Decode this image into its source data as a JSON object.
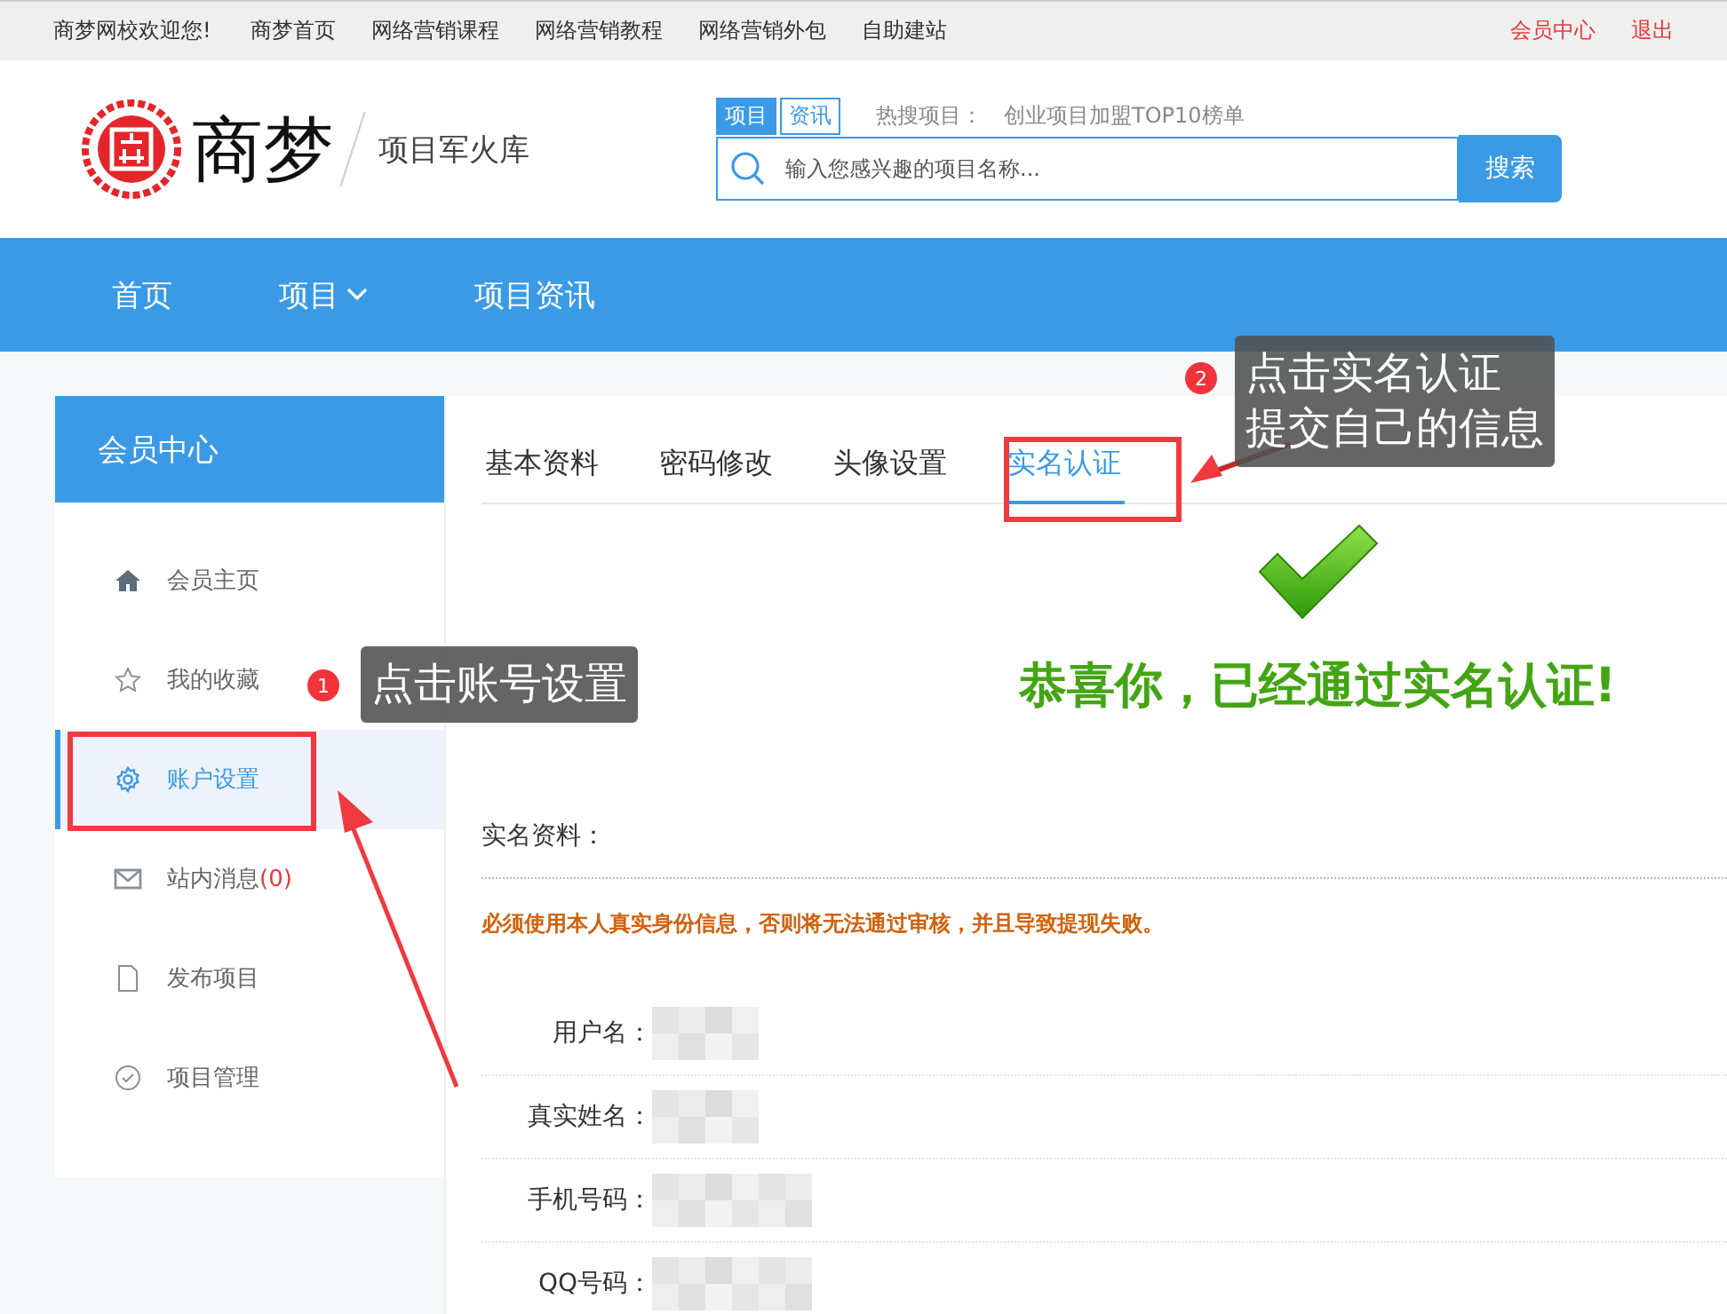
{
  "top_bar": {
    "welcome": "商梦网校欢迎您!",
    "links": [
      "商梦首页",
      "网络营销课程",
      "网络营销教程",
      "网络营销外包",
      "自助建站"
    ],
    "right_links": [
      "会员中心",
      "退出"
    ]
  },
  "header": {
    "brand": "商梦",
    "slogan": "项目军火库",
    "search": {
      "tabs": [
        {
          "label": "项目",
          "selected": true
        },
        {
          "label": "资讯",
          "selected": false
        }
      ],
      "hot_label": "热搜项目：",
      "hot_item": "创业项目加盟TOP10榜单",
      "placeholder": "输入您感兴趣的项目名称...",
      "button": "搜索"
    }
  },
  "nav": [
    {
      "label": "首页",
      "dropdown": false
    },
    {
      "label": "项目",
      "dropdown": true
    },
    {
      "label": "项目资讯",
      "dropdown": false
    }
  ],
  "sidebar": {
    "title": "会员中心",
    "items": [
      {
        "label": "会员主页",
        "selected": false
      },
      {
        "label": "我的收藏",
        "selected": false
      },
      {
        "label": "账户设置",
        "selected": true
      },
      {
        "label": "站内消息",
        "count": "(0)",
        "selected": false
      },
      {
        "label": "发布项目",
        "selected": false
      },
      {
        "label": "项目管理",
        "selected": false
      }
    ]
  },
  "tabs": [
    {
      "label": "基本资料",
      "selected": false
    },
    {
      "label": "密码修改",
      "selected": false
    },
    {
      "label": "头像设置",
      "selected": false
    },
    {
      "label": "实名认证",
      "selected": true
    }
  ],
  "success_message": "恭喜你，已经通过实名认证!",
  "section_title": "实名资料：",
  "warning": "必须使用本人真实身份信息，否则将无法通过审核，并且导致提现失败。",
  "fields": [
    {
      "label": "用户名："
    },
    {
      "label": "真实姓名："
    },
    {
      "label": "手机号码："
    },
    {
      "label": "QQ号码："
    }
  ],
  "annotations": [
    {
      "number": "1",
      "lines": [
        "点击账号设置"
      ]
    },
    {
      "number": "2",
      "lines": [
        "点击实名认证",
        "提交自己的信息"
      ]
    }
  ]
}
